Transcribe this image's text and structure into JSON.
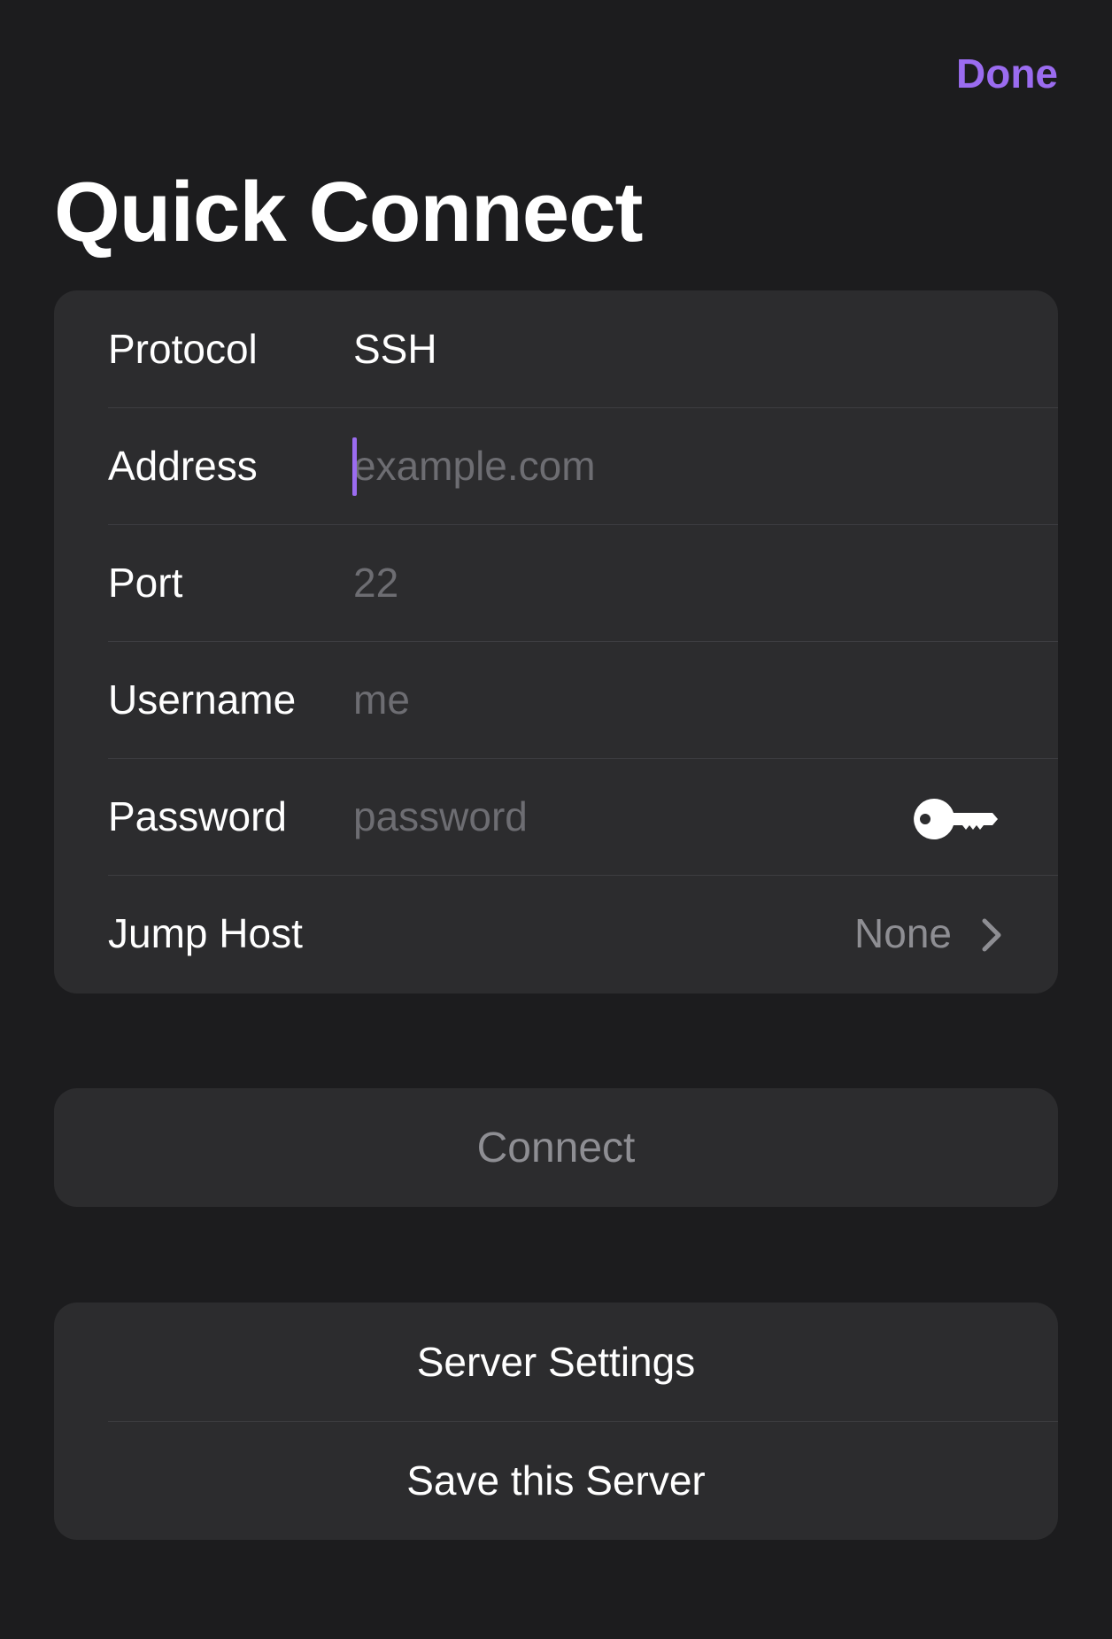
{
  "header": {
    "done_label": "Done",
    "title": "Quick Connect"
  },
  "form": {
    "protocol": {
      "label": "Protocol",
      "value": "SSH"
    },
    "address": {
      "label": "Address",
      "value": "",
      "placeholder": "example.com"
    },
    "port": {
      "label": "Port",
      "value": "",
      "placeholder": "22"
    },
    "username": {
      "label": "Username",
      "value": "",
      "placeholder": "me"
    },
    "password": {
      "label": "Password",
      "value": "",
      "placeholder": "password",
      "icon": "key-icon"
    },
    "jump_host": {
      "label": "Jump Host",
      "value": "None",
      "icon": "chevron-right-icon"
    }
  },
  "connect_button": {
    "label": "Connect"
  },
  "actions": {
    "server_settings_label": "Server Settings",
    "save_server_label": "Save this Server"
  },
  "colors": {
    "accent": "#9b6cf0",
    "background": "#1c1c1e",
    "group_background": "#2c2c2e",
    "placeholder": "#6d6d72",
    "secondary_text": "#8e8e93"
  }
}
